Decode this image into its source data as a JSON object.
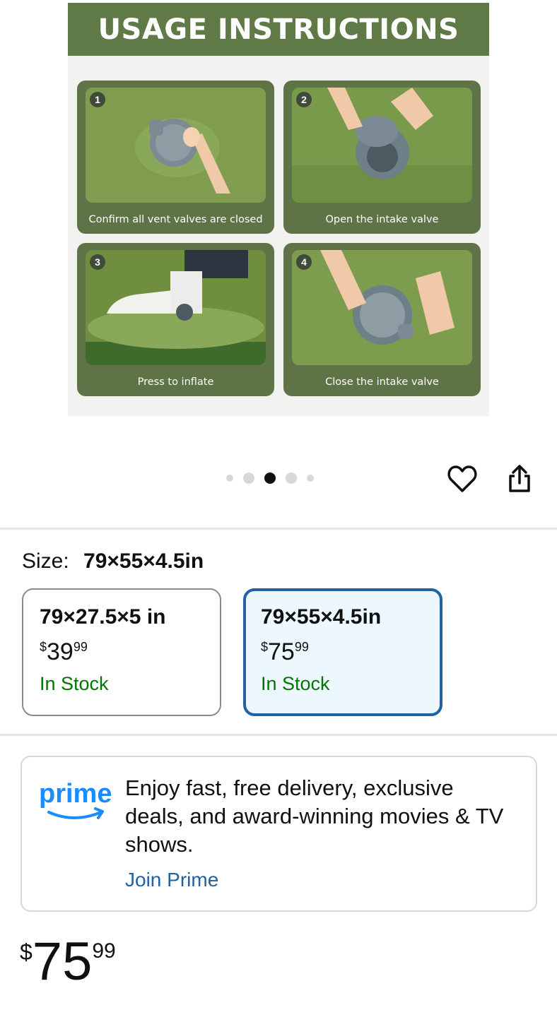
{
  "product_image": {
    "title": "USAGE INSTRUCTIONS",
    "steps": [
      {
        "number": "1",
        "caption": "Confirm all vent valves are closed"
      },
      {
        "number": "2",
        "caption": "Open the intake valve"
      },
      {
        "number": "3",
        "caption": "Press to inflate"
      },
      {
        "number": "4",
        "caption": "Close the intake valve"
      }
    ],
    "theme_colors": {
      "banner": "#5f7a46",
      "card": "#5e7447",
      "background": "#f2f3f1"
    }
  },
  "carousel": {
    "image_count": 5,
    "active_index": 2,
    "heart_icon": "heart-outline-icon",
    "share_icon": "share-icon"
  },
  "size": {
    "label": "Size:",
    "selected_value": "79×55×4.5in",
    "options": [
      {
        "name": "79×27.5×5 in",
        "currency": "$",
        "price_whole": "39",
        "price_fraction": "99",
        "stock": "In Stock",
        "selected": false
      },
      {
        "name": "79×55×4.5in",
        "currency": "$",
        "price_whole": "75",
        "price_fraction": "99",
        "stock": "In Stock",
        "selected": true
      }
    ]
  },
  "prime": {
    "logo_text": "prime",
    "message": "Enjoy fast, free delivery, exclusive deals, and award-winning movies & TV shows.",
    "link": "Join Prime",
    "colors": {
      "logo": "#1a8cff",
      "link": "#2162a1"
    }
  },
  "price": {
    "currency": "$",
    "whole": "75",
    "fraction": "99"
  },
  "colors": {
    "in_stock": "#007600",
    "selected_border": "#2162a1",
    "selected_bg": "#edf7fe"
  }
}
